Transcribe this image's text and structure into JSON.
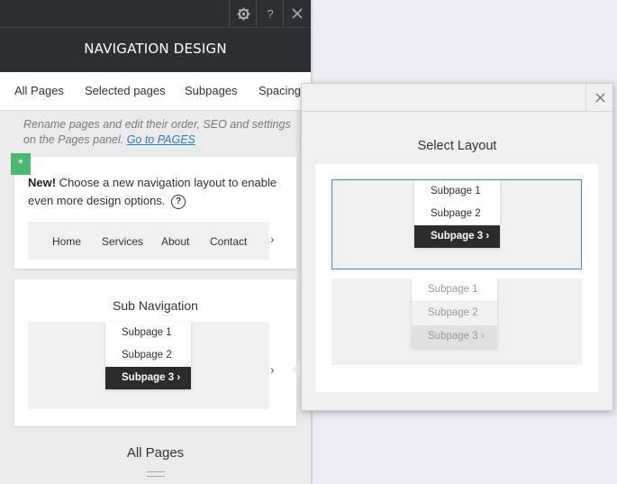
{
  "panel": {
    "title": "NAVIGATION DESIGN",
    "tabs": [
      "All Pages",
      "Selected pages",
      "Subpages",
      "Spacing"
    ],
    "hint_text": "Rename pages and edit their order, SEO and settings on the Pages panel.",
    "hint_link": "Go to PAGES",
    "new_badge": "*",
    "new_label": "New!",
    "new_text": " Choose a new navigation layout to enable even more design options.",
    "help": "?",
    "nav_items": [
      "Home",
      "Services",
      "About",
      "Contact"
    ],
    "sub_nav_title": "Sub Navigation",
    "subpages": [
      "Subpage 1",
      "Subpage 2",
      "Subpage 3 ›"
    ],
    "all_pages_label": "All Pages"
  },
  "popover": {
    "title": "Select Layout",
    "layout1": [
      "Subpage 1",
      "Subpage 2",
      "Subpage 3 ›"
    ],
    "layout2": [
      "Subpage 1",
      "Subpage 2",
      "Subpage 3 ›"
    ]
  },
  "arrow": "›"
}
